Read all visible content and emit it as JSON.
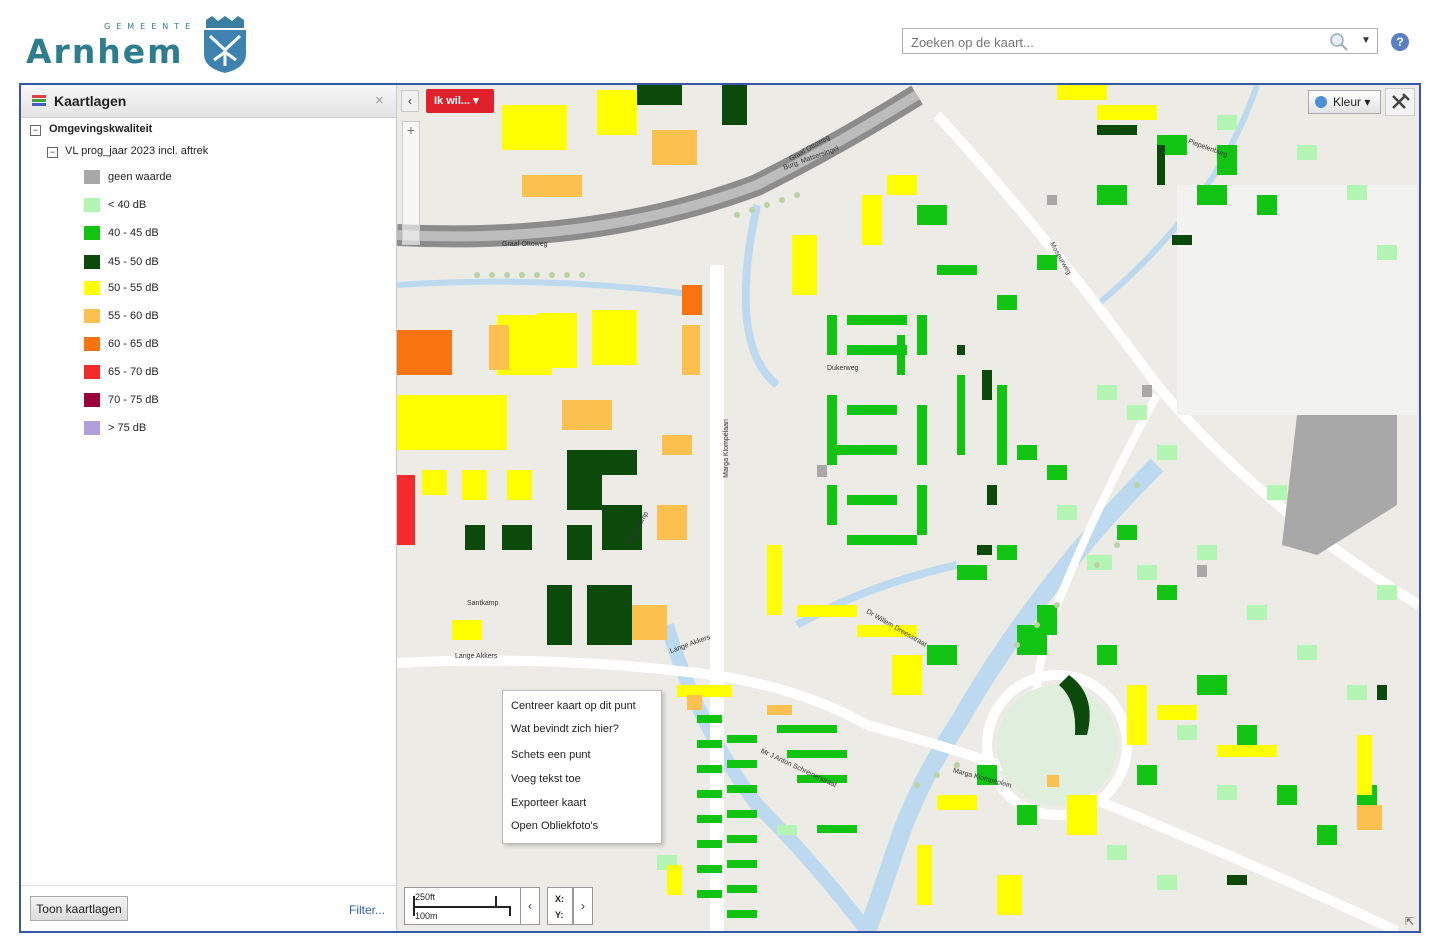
{
  "header": {
    "logo_sub": "GEMEENTE",
    "logo_name": "Arnhem",
    "search_placeholder": "Zoeken op de kaart...",
    "help_label": "?"
  },
  "panel": {
    "title": "Kaartlagen",
    "close_label": "×",
    "tree_root": "Omgevingskwaliteit",
    "tree_child": "VL prog_jaar 2023 incl. aftrek",
    "legend": [
      {
        "label": "geen waarde",
        "color": "#a8a8a8"
      },
      {
        "label": "< 40 dB",
        "color": "#b3f5b3"
      },
      {
        "label": "40 - 45 dB",
        "color": "#12c412"
      },
      {
        "label": "45 - 50 dB",
        "color": "#0b4a0b"
      },
      {
        "label": "50 - 55 dB",
        "color": "#ffff00"
      },
      {
        "label": "55 - 60 dB",
        "color": "#fcc04f"
      },
      {
        "label": "60 - 65 dB",
        "color": "#f97311"
      },
      {
        "label": "65 - 70 dB",
        "color": "#f32b2b"
      },
      {
        "label": "70 - 75 dB",
        "color": "#9b0037"
      },
      {
        "label": "> 75 dB",
        "color": "#b09fd8"
      }
    ],
    "show_layers_button": "Toon kaartlagen",
    "filter_link": "Filter..."
  },
  "map": {
    "collapse_label": "‹",
    "ik_wil_button": "Ik wil... ▾",
    "kleur_button": "Kleur ▾",
    "context_menu": [
      "Centreer kaart op dit punt",
      "Wat bevindt zich hier?",
      "Schets een punt",
      "Voeg tekst toe",
      "Exporteer kaart",
      "Open Obliekfoto's"
    ],
    "scale_ft": "250ft",
    "scale_m": "100m",
    "coord_x": "X:",
    "coord_y": "Y:",
    "street_labels": [
      "Graaf Ottoweg",
      "Graaf Ottoweg",
      "Marga Klompélaan",
      "Dukerweg",
      "Lange Akkers",
      "Santkamp",
      "Papenkamp",
      "Lange Akkers",
      "Dr Willem Dreesstraat",
      "Marga Klompéplein",
      "Moseurweg",
      "Piepelenburg",
      "Mr J Anton Schreinerstraat",
      "Burg. Matsersingel"
    ]
  }
}
